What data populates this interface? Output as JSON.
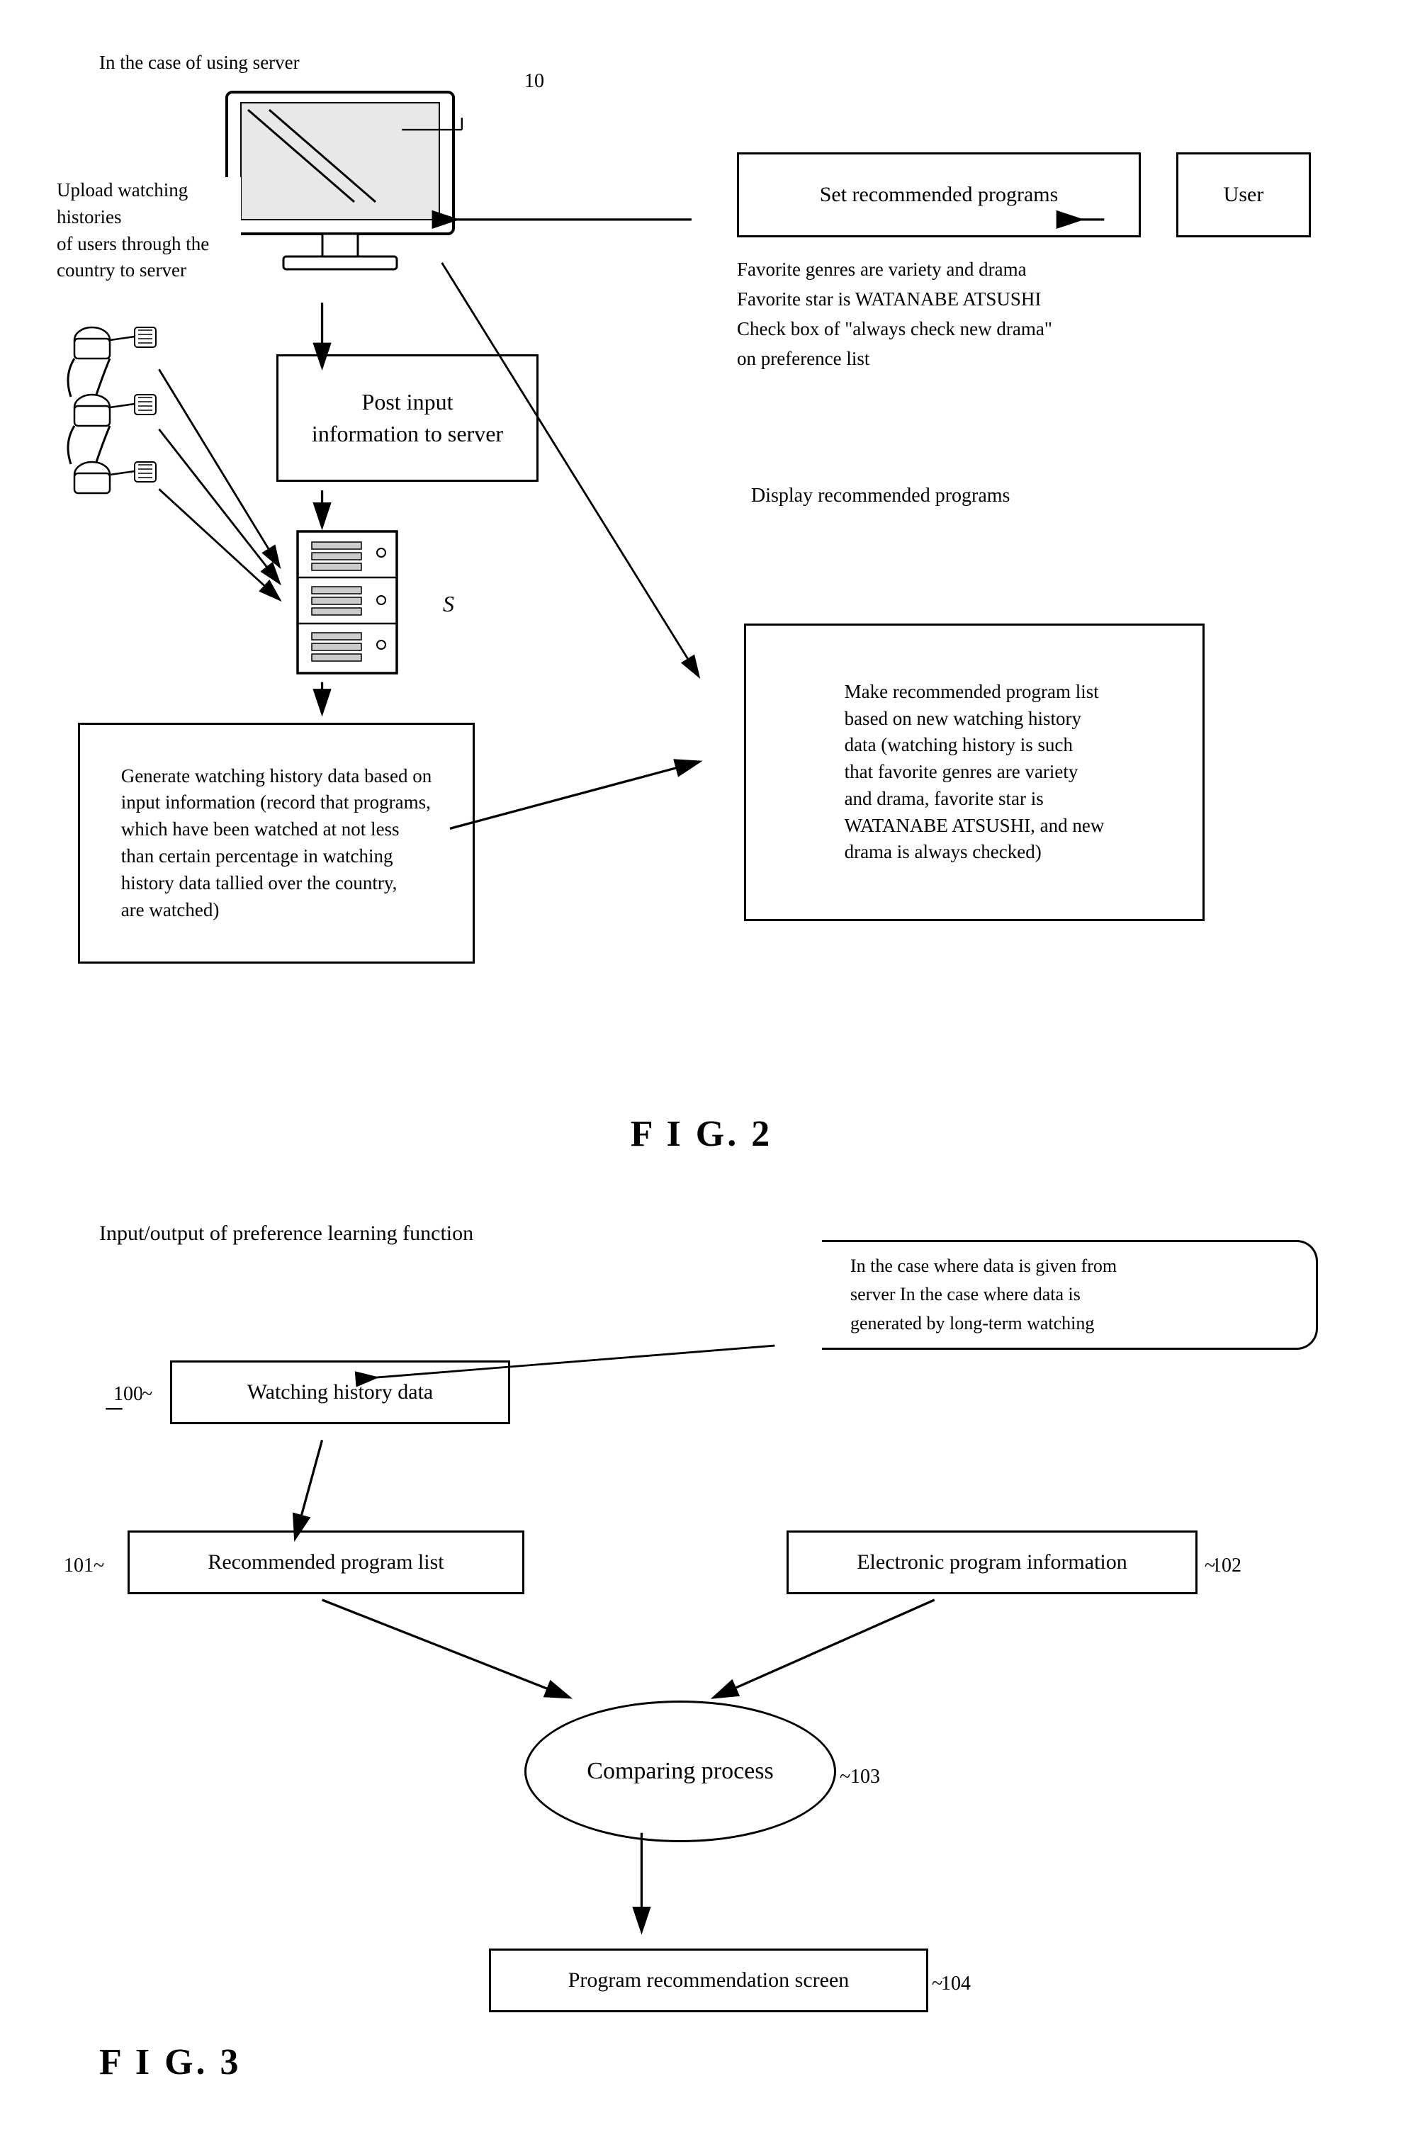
{
  "fig2": {
    "title": "F I G. 2",
    "header_label": "In the case of using server",
    "node_label": "10",
    "server_label": "S",
    "upload_label": "Upload watching histories\nof users through the\ncountry to server",
    "post_box": "Post input\ninformation to server",
    "generate_box": "Generate watching history data based on\ninput information (record that programs,\nwhich have been watched at not less\nthan certain percentage in watching\nhistory data tallied over the country,\nare watched)",
    "set_box": "Set recommended programs",
    "user_box": "User",
    "preference_text": "Favorite genres are variety and drama\nFavorite star is WATANABE ATSUSHI\nCheck box of \"always check new drama\"\non preference list",
    "display_label": "Display recommended programs",
    "make_box": "Make recommended program list\nbased on new watching history\ndata (watching history is such\nthat favorite genres are variety\nand drama, favorite star is\nWATANABE ATSUSHI, and new\ndrama is always checked)"
  },
  "fig3": {
    "title": "F I G. 3",
    "header_label": "Input/output of preference learning function",
    "note_text": "In the case where data is given from\nserver In the case where data is\ngenerated by long-term watching",
    "watching_box": "Watching history data",
    "watching_label": "100",
    "recommended_box": "Recommended program list",
    "recommended_label": "101",
    "electronic_box": "Electronic program information",
    "electronic_label": "102",
    "comparing_ellipse": "Comparing process",
    "comparing_label": "103",
    "program_box": "Program recommendation screen",
    "program_label": "104"
  }
}
